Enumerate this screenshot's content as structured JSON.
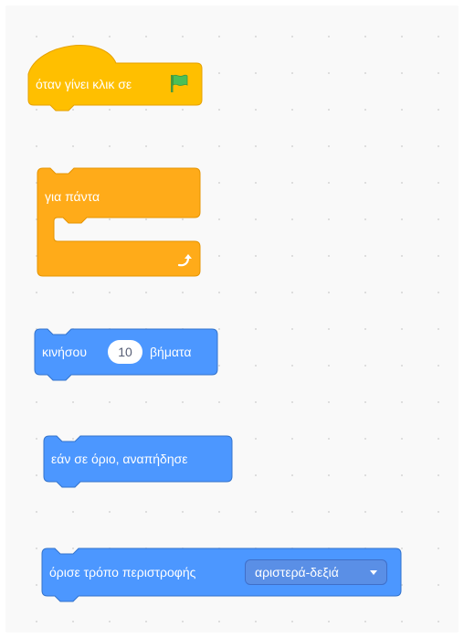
{
  "blocks": {
    "when_flag_clicked": {
      "label": "όταν γίνει κλικ σε",
      "icon": "green-flag-icon"
    },
    "forever": {
      "label": "για πάντα",
      "icon": "loop-arrow-icon"
    },
    "move_steps": {
      "label_before": "κινήσου",
      "value": "10",
      "label_after": "βήματα"
    },
    "if_on_edge_bounce": {
      "label": "εάν σε όριο, αναπήδησε"
    },
    "set_rotation_style": {
      "label": "όρισε τρόπο περιστροφής",
      "option": "αριστερά-δεξιά"
    }
  },
  "colors": {
    "events": "#ffbf00",
    "control": "#ffab19",
    "motion": "#4c97ff",
    "flag": "#4cbf56"
  }
}
